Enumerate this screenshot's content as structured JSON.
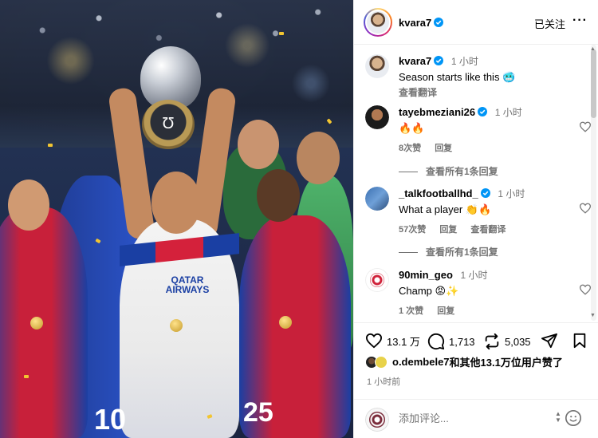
{
  "post": {
    "author": "kvara7",
    "follow_label": "已关注",
    "more_label": "•••",
    "caption_author": "kvara7",
    "caption_time": "1 小时",
    "caption_text": "Season starts like this 🥶",
    "caption_translate": "查看翻译"
  },
  "comments": [
    {
      "username": "tayebmeziani26",
      "time": "1 小时",
      "text": "🔥🔥",
      "likes": "8次赞",
      "reply": "回复",
      "view_replies": "查看所有1条回复"
    },
    {
      "username": "_talkfootballhd_",
      "time": "1 小时",
      "text": "What a player 👏🔥",
      "likes": "57次赞",
      "reply": "回复",
      "translate": "查看翻译",
      "view_replies": "查看所有1条回复"
    },
    {
      "username": "90min_geo",
      "time": "1 小时",
      "text": "Champ 😡✨",
      "likes": "1 次赞",
      "reply": "回复"
    }
  ],
  "actions": {
    "like_count": "13.1 万",
    "comment_count": "1,713",
    "repost_count": "5,035"
  },
  "likes_summary": {
    "first_user": "o.dembele7",
    "rest_text": "和其他13.1万位用户赞了"
  },
  "posted_time": "1 小时前",
  "comment_box": {
    "placeholder": "添加评论..."
  },
  "photo": {
    "jersey_number_left": "10",
    "jersey_number_right": "25",
    "sponsor_text": "QATAR AIRWAYS"
  },
  "icons": {
    "verified": "verified-badge-icon",
    "heart": "heart-icon",
    "comment": "comment-bubble-icon",
    "repost": "repost-icon",
    "share": "paper-plane-icon",
    "save": "bookmark-icon",
    "emoji": "smiley-icon",
    "more": "more-dots-icon"
  },
  "colors": {
    "verified_blue": "#0095f6",
    "muted_text": "#737373",
    "border": "#efefef"
  }
}
